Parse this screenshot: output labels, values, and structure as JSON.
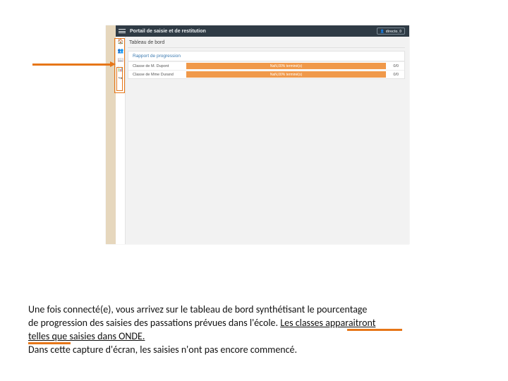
{
  "app": {
    "title": "Portail de saisie et de restitution",
    "user_label": "directo_0"
  },
  "dashboard": {
    "page_title": "Tableau de bord",
    "panel_title": "Rapport de progression",
    "rows": [
      {
        "class_label": "Classe de M. Dupont",
        "progress_label": "NaN,00% terminé(s)",
        "count": "0/0"
      },
      {
        "class_label": "Classe de Mme Durand",
        "progress_label": "NaN,00% terminé(s)",
        "count": "0/0"
      }
    ]
  },
  "sidebar": {
    "items": [
      {
        "name": "home-icon",
        "glyph": "🏠"
      },
      {
        "name": "users-icon",
        "glyph": "👥"
      },
      {
        "name": "book-icon",
        "glyph": "📖"
      },
      {
        "name": "chart-icon",
        "glyph": "📊"
      },
      {
        "name": "exit-icon",
        "glyph": "↪"
      }
    ]
  },
  "caption": {
    "line1a": "Une fois connecté(e), vous arrivez sur le tableau de bord synthétisant le pourcentage",
    "line2a": "de progression des saisies des passations prévues dans l'école. ",
    "line2u": "Les classes apparaitront",
    "line3u": "telles que saisies dans ONDE.",
    "line4a": "Dans cette capture d'écran, les saisies n'ont pas encore commencé."
  },
  "colors": {
    "accent": "#e67618",
    "bar": "#f0994a",
    "header": "#2f3b45"
  }
}
